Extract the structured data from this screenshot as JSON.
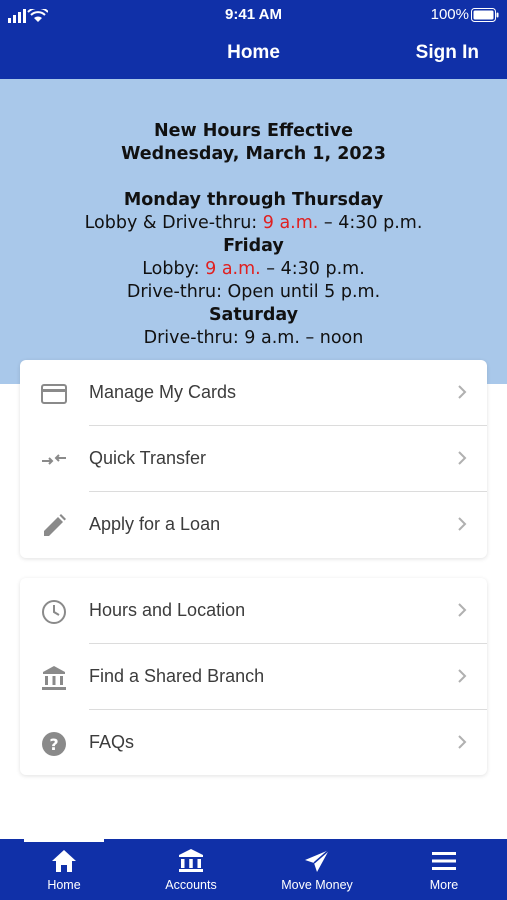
{
  "status": {
    "time": "9:41 AM",
    "battery": "100%"
  },
  "nav": {
    "title": "Home",
    "sign_in": "Sign In"
  },
  "notice": {
    "line1": "New Hours Effective",
    "line2": "Wednesday, March 1, 2023",
    "mon_thu_heading": "Monday through Thursday",
    "mon_thu_prefix": "Lobby & Drive-thru: ",
    "mon_thu_time_red": "9 a.m.",
    "mon_thu_suffix": " – 4:30 p.m.",
    "fri_heading": "Friday",
    "fri_lobby_prefix": "Lobby: ",
    "fri_lobby_red": "9 a.m.",
    "fri_lobby_suffix": " – 4:30 p.m.",
    "fri_drive": "Drive-thru: Open until 5 p.m.",
    "sat_heading": "Saturday",
    "sat_drive": "Drive-thru: 9 a.m. – noon"
  },
  "menu_group_1": [
    {
      "label": "Manage My Cards",
      "icon": "credit-card-icon"
    },
    {
      "label": "Quick Transfer",
      "icon": "transfer-arrows-icon"
    },
    {
      "label": "Apply for a Loan",
      "icon": "pencil-icon"
    }
  ],
  "menu_group_2": [
    {
      "label": "Hours and Location",
      "icon": "clock-icon"
    },
    {
      "label": "Find a Shared Branch",
      "icon": "bank-icon"
    },
    {
      "label": "FAQs",
      "icon": "help-circle-icon"
    }
  ],
  "tabs": [
    {
      "label": "Home",
      "icon": "home-icon"
    },
    {
      "label": "Accounts",
      "icon": "bank-icon"
    },
    {
      "label": "Move Money",
      "icon": "paper-plane-icon"
    },
    {
      "label": "More",
      "icon": "hamburger-menu-icon"
    }
  ],
  "colors": {
    "brand_blue": "#1030a8",
    "hero_bg": "#a9c8ea",
    "accent_red": "#e02020"
  }
}
